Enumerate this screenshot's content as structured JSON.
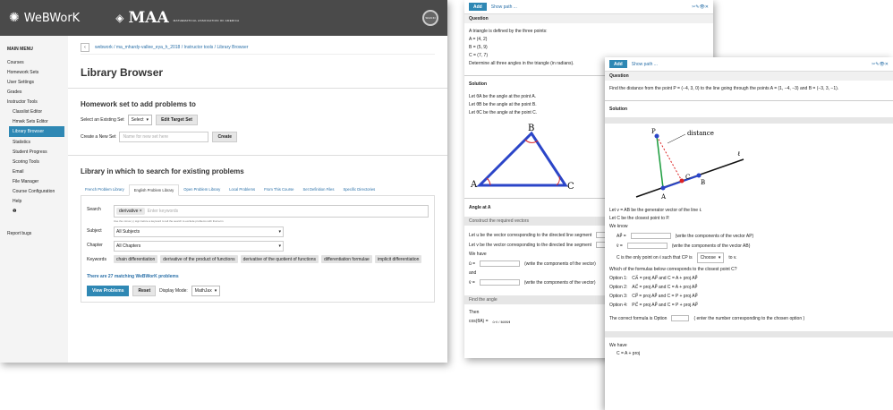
{
  "left": {
    "logo": "WeBWorK",
    "maa_title": "MAA",
    "maa_sub": "MATHEMATICAL ASSOCIATION OF AMERICA",
    "user": "SIGN IN",
    "menu_title": "MAIN MENU",
    "menu": [
      "Courses",
      "Homework Sets",
      "User Settings",
      "Grades",
      "Instructor Tools"
    ],
    "submenu": [
      "Classlist Editor",
      "Hmwk Sets Editor",
      "Library Browser",
      "Statistics",
      "Student Progress",
      "Scoring Tools",
      "Email",
      "File Manager",
      "Course Configuration",
      "Help"
    ],
    "report": "Report bugs",
    "breadcrumb": "webwork / ma_mhardy-vallee_eya_h_2018 / Instructor tools / Library Browser",
    "page_title": "Library Browser",
    "hw_heading": "Homework set to add problems to",
    "select_existing": "Select an Existing Set",
    "select_value": "Select",
    "edit_target": "Edit Target Set",
    "create_new": "Create a New Set",
    "name_placeholder": "Name for new set here",
    "create_btn": "Create",
    "lib_heading": "Library in which to search for existing problems",
    "tabs": [
      "French Problem Library",
      "English Problem Library",
      "Open Problem Library",
      "Local Problems",
      "From This Course",
      "Set Definition Files",
      "Specific Directories"
    ],
    "search_label": "Search",
    "search_chip": "derivative",
    "search_placeholder": "Enter keywords",
    "search_hint": "Use the minus (-) sign before a keyword to tell the search to exclude problems with that term",
    "subject_label": "Subject",
    "subject_value": "All Subjects",
    "chapter_label": "Chapter",
    "chapter_value": "All Chapters",
    "keywords_label": "Keywords",
    "keywords": [
      "chain differentiation",
      "derivative of the product of functions",
      "derivative of the quotient of functions",
      "differentiation formulae",
      "implicit differentiation"
    ],
    "matching": "There are 27 matching WeBWorK problems",
    "view_btn": "View Problems",
    "reset_btn": "Reset",
    "display_mode_label": "Display Mode:",
    "display_mode_value": "MathJax"
  },
  "mid": {
    "add": "Add",
    "show_path": "Show path ...",
    "icons": "✂✎👁✕",
    "question": "Question",
    "text1": "A triangle is defined by the three points:",
    "pA": "A = (4, 2)",
    "pB": "B = (5, 9)",
    "pC": "C = (7, 7)",
    "task": "Determine all three angles in the triangle (in radians).",
    "solution": "Solution",
    "let1": "Let θA be the angle at the point A.",
    "let2": "Let θB be the angle at the point B.",
    "let3": "Let θC be the angle at the point C.",
    "angle_at": "Angle at A",
    "construct": "Construct the required vectors",
    "u_text": "Let u be the vector corresponding to the directed line segment",
    "v_text": "Let v be the vector corresponding to the directed line segment",
    "we_have": "We have",
    "comp1": "(write the components of the vector)",
    "and": "and",
    "comp2": "(write the components of the vector)",
    "find_angle": "Find the angle",
    "then": "Then"
  },
  "right": {
    "add": "Add",
    "show_path": "Show path ...",
    "icons": "✂✎👁✕",
    "question": "Question",
    "qtext": "Find the distance from the point P = (−4, 3, 0) to the line going through the points A = (1, −4, −3) and B = (−3, 3, −1).",
    "solution": "Solution",
    "fig_label": "distance",
    "let_v": "Let v = AB be the generator vector of the line ℓ.",
    "let_c": "Let C be the closest point to P.",
    "we_know": "We know",
    "ap_note": "(write the components of the vector AP)",
    "v_note": "(write the components of the vector AB)",
    "cp_text": "C is the only point on ℓ such that CP is",
    "choose": "Choose",
    "to_v": "to v.",
    "which": "Which of the formulas below corresponds to the closest point C?",
    "options": [
      "Option 1:",
      "Option 2:",
      "Option 3:",
      "Option 4:"
    ],
    "correct": "The correct formula is Option",
    "correct_note": "( enter the number corresponding to the chosen option )",
    "we_have": "We have",
    "c_eq": "C =     A    +    proj"
  }
}
